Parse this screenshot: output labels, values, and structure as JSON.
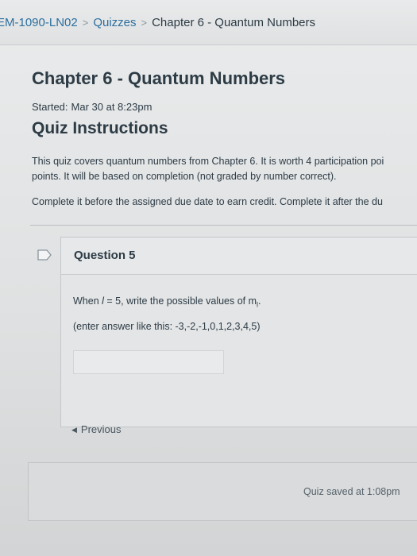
{
  "breadcrumb": {
    "course": "EM-1090-LN02",
    "quizzes": "Quizzes",
    "current": "Chapter 6 - Quantum Numbers"
  },
  "quiz": {
    "title": "Chapter 6 - Quantum Numbers",
    "started_label": "Started:",
    "started_value": "Mar 30 at 8:23pm",
    "instructions_title": "Quiz Instructions",
    "instructions_line1": "This quiz covers quantum numbers from Chapter 6. It is worth 4 participation poi",
    "instructions_line2": "points. It will be based on completion (not graded by number correct).",
    "instructions_line3": "Complete it before the assigned due date to earn credit. Complete it after the du"
  },
  "question": {
    "title": "Question 5",
    "text_prefix": "When ",
    "text_var": "l",
    "text_suffix": " = 5, write the possible values of m",
    "text_sub": "l",
    "text_end": ".",
    "hint": "(enter answer like this: -3,-2,-1,0,1,2,3,4,5)",
    "answer_value": ""
  },
  "nav": {
    "previous_label": "Previous",
    "previous_icon": "triangle-left-icon"
  },
  "status": {
    "saved_text": "Quiz saved at 1:08pm"
  },
  "colors": {
    "link": "#2d6f9e",
    "text": "#2d3b45"
  }
}
